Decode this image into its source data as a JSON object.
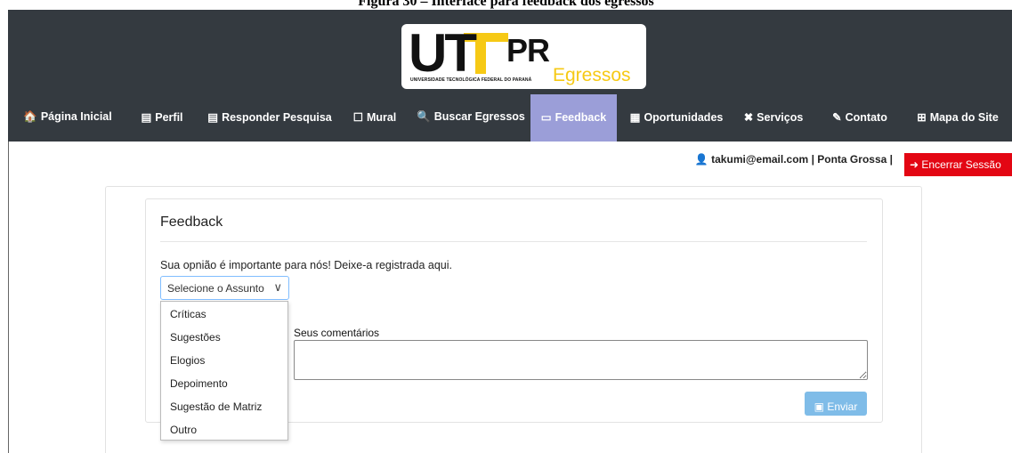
{
  "caption": "Figura 30 – Interface para feedback dos egressos",
  "logo": {
    "main": "UTFPR",
    "sub": "Egressos",
    "university": "UNIVERSIDADE TECNOLÓGICA FEDERAL DO PARANÁ"
  },
  "nav": {
    "items": [
      {
        "label": "Página Inicial",
        "icon": "home-icon",
        "glyph": "🏠"
      },
      {
        "label": "Perfil",
        "icon": "id-card-icon",
        "glyph": "▤"
      },
      {
        "label": "Responder Pesquisa",
        "icon": "id-card-icon",
        "glyph": "▤"
      },
      {
        "label": "Mural",
        "icon": "clipboard-icon",
        "glyph": "☐"
      },
      {
        "label": "Buscar Egressos",
        "icon": "search-icon",
        "glyph": "🔍"
      },
      {
        "label": "Feedback",
        "icon": "comment-icon",
        "glyph": "▭"
      },
      {
        "label": "Oportunidades",
        "icon": "card-icon",
        "glyph": "▦"
      },
      {
        "label": "Serviços",
        "icon": "tools-icon",
        "glyph": "✖"
      },
      {
        "label": "Contato",
        "icon": "edit-icon",
        "glyph": "✎"
      },
      {
        "label": "Mapa do Site",
        "icon": "sitemap-icon",
        "glyph": "⊞"
      }
    ],
    "active": "Feedback"
  },
  "user": {
    "email": "takumi@email.com",
    "campus": "Ponta Grossa",
    "separator": "|",
    "logout_label": "Encerrar Sessão"
  },
  "form": {
    "title": "Feedback",
    "intro": "Sua opnião é importante para nós! Deixe-a registrada aqui.",
    "subject_placeholder": "Selecione o Assunto",
    "subject_options": [
      "Críticas",
      "Sugestões",
      "Elogios",
      "Depoimento",
      "Sugestão de Matriz",
      "Outro"
    ],
    "comments_label": "Seus comentários",
    "comments_value": "",
    "submit_label": "Enviar"
  },
  "colors": {
    "header_bg": "#343a40",
    "nav_active_bg": "#9b9ed8",
    "logout_bg": "#e30613",
    "submit_bg": "#7fbce8",
    "logo_yellow": "#f6c915"
  }
}
